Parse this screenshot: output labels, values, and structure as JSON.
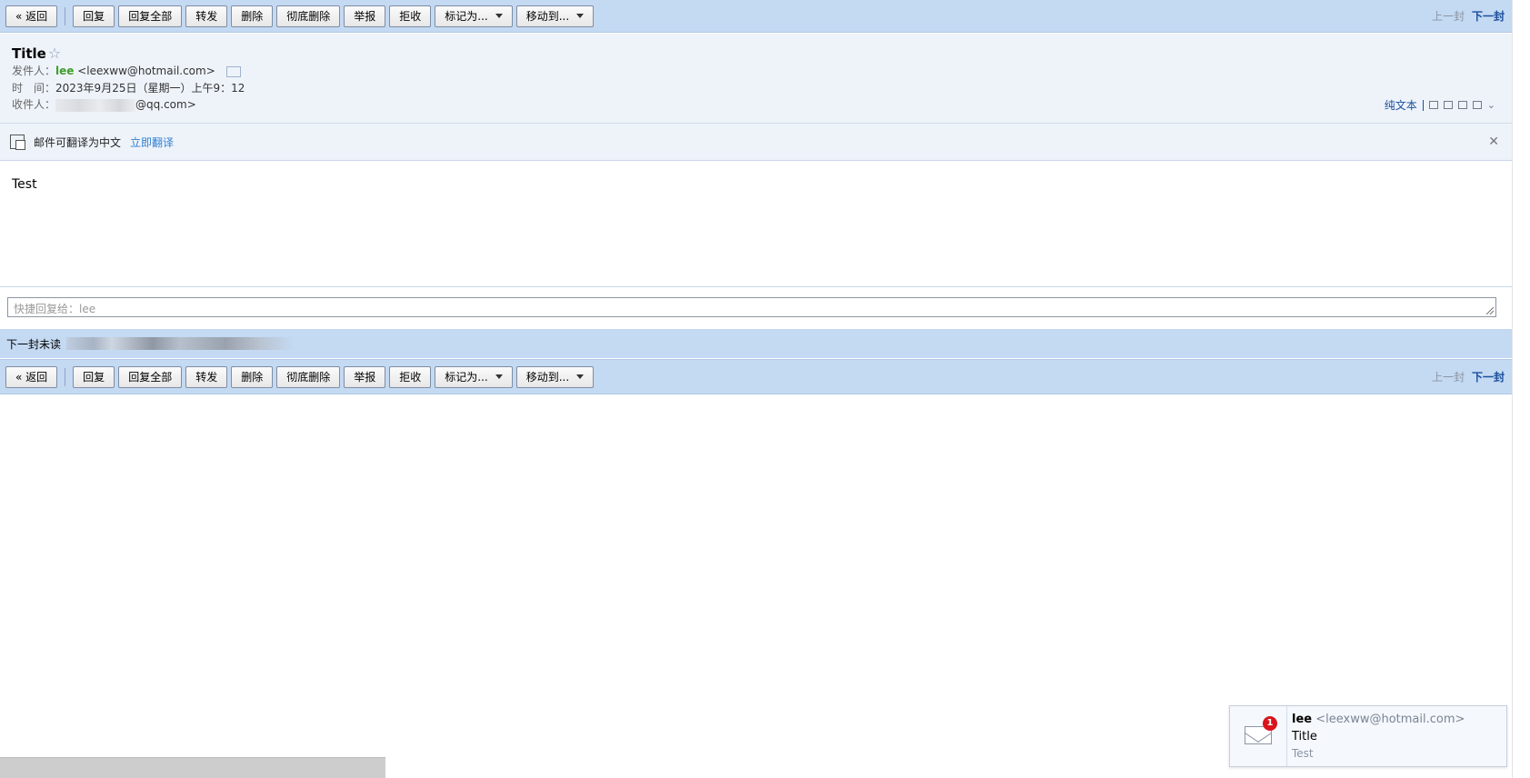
{
  "toolbar": {
    "back": "« 返回",
    "reply": "回复",
    "reply_all": "回复全部",
    "forward": "转发",
    "delete": "删除",
    "delete_permanent": "彻底删除",
    "report": "举报",
    "reject": "拒收",
    "mark_as": "标记为...",
    "move_to": "移动到...",
    "prev": "上一封",
    "next": "下一封"
  },
  "mail": {
    "subject": "Title",
    "star": "☆",
    "from_label": "发件人：",
    "from_name": "lee",
    "from_email": "<leexww@hotmail.com>",
    "time_label": "时　间：",
    "time_value": "2023年9月25日（星期一）上午9：12",
    "to_label": "收件人：",
    "to_email_suffix": "@qq.com>",
    "plain_text": "纯文本",
    "body": "Test"
  },
  "translate": {
    "message": "邮件可翻译为中文",
    "action": "立即翻译",
    "close": "✕"
  },
  "quick_reply": {
    "placeholder": "快捷回复给：lee"
  },
  "next_unread": {
    "label": "下一封未读"
  },
  "notification": {
    "count": "1",
    "name": "lee",
    "email": "<leexww@hotmail.com>",
    "subject": "Title",
    "preview": "Test"
  },
  "colors": {
    "toolbar_bg": "#c4d9f2",
    "sender_green": "#3f9e2a",
    "link_blue": "#2f7fd1",
    "badge_red": "#d8141c"
  }
}
